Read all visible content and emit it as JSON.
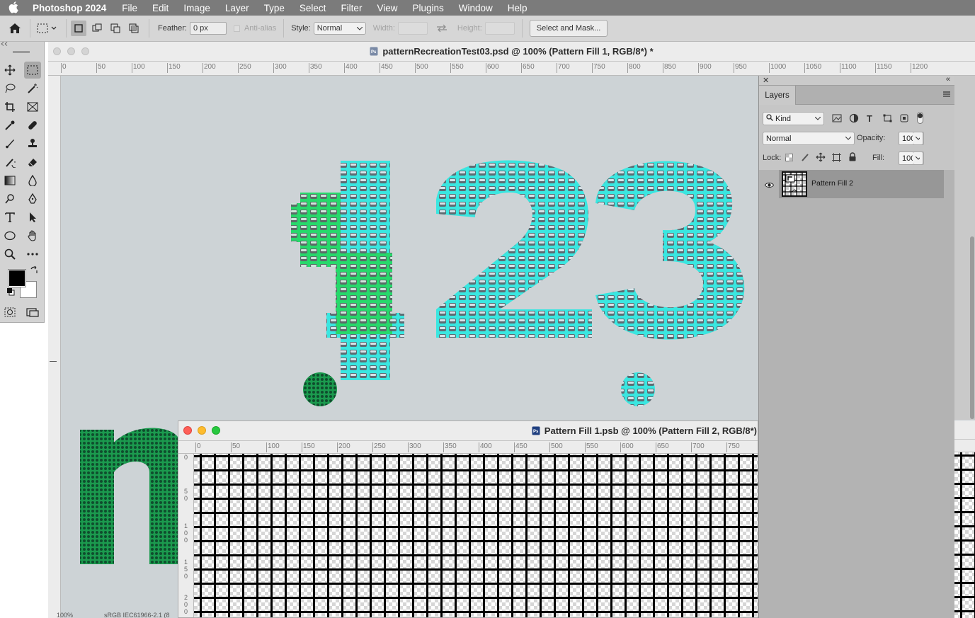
{
  "menubar": {
    "app": "Photoshop 2024",
    "items": [
      "File",
      "Edit",
      "Image",
      "Layer",
      "Type",
      "Select",
      "Filter",
      "View",
      "Plugins",
      "Window",
      "Help"
    ]
  },
  "options": {
    "feather_label": "Feather:",
    "feather_value": "0 px",
    "antialias_label": "Anti-alias",
    "style_label": "Style:",
    "style_value": "Normal",
    "width_label": "Width:",
    "height_label": "Height:",
    "select_mask_button": "Select and Mask..."
  },
  "document1": {
    "title": "patternRecreationTest03.psd @ 100% (Pattern Fill 1, RGB/8*) *",
    "ruler_h": [
      "0",
      "50",
      "100",
      "150",
      "200",
      "250",
      "300",
      "350",
      "400",
      "450",
      "500",
      "550",
      "600",
      "650",
      "700",
      "750",
      "800",
      "850",
      "900",
      "950",
      "1000",
      "1050",
      "1100",
      "1150",
      "1200"
    ],
    "canvas_text": "123",
    "lower_letter": "n"
  },
  "layers_panel": {
    "tab": "Layers",
    "filter_kind": "Kind",
    "blend_mode": "Normal",
    "opacity_label": "Opacity:",
    "opacity_value": "100%",
    "lock_label": "Lock:",
    "fill_label": "Fill:",
    "fill_value": "100%",
    "layers": [
      {
        "name": "Pattern Fill 2",
        "visible": true,
        "selected": true
      }
    ]
  },
  "document2": {
    "title": "Pattern Fill 1.psb @ 100% (Pattern Fill 2, RGB/8*)",
    "ruler_h": [
      "0",
      "50",
      "100",
      "150",
      "200",
      "250",
      "300",
      "350",
      "400",
      "450",
      "500",
      "550",
      "600",
      "650",
      "700",
      "750"
    ]
  },
  "status": {
    "zoom": "100%",
    "profile": "sRGB IEC61966-2.1 (8"
  },
  "colors": {
    "accent_cyan": "#35f2ea",
    "accent_green": "#22d85a",
    "canvas_bg": "#cdd3d6"
  }
}
